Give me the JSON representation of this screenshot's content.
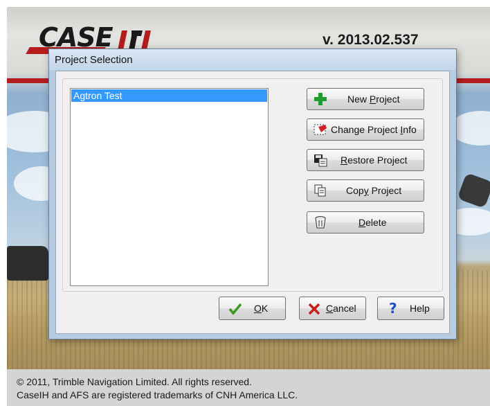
{
  "splash": {
    "brand_text": "CASE",
    "version": "v. 2013.02.537",
    "brand_red": "#b51d1d",
    "footer": {
      "copyright": "© 2011, Trimble Navigation Limited. All rights reserved.",
      "trademark": "CaseIH and AFS are registered trademarks of CNH America LLC."
    }
  },
  "dialog": {
    "title": "Project Selection",
    "projects": [
      "Agtron Test"
    ],
    "selected_project": "Agtron Test",
    "buttons": {
      "new_project": {
        "label_pre": "New ",
        "label_u": "P",
        "label_post": "roject",
        "icon": "plus-icon"
      },
      "change_info": {
        "label_pre": "Change Project ",
        "label_u": "I",
        "label_post": "nfo",
        "icon": "edit-icon"
      },
      "restore": {
        "label_pre": "",
        "label_u": "R",
        "label_post": "estore Project",
        "icon": "floppy-disk-icon"
      },
      "copy": {
        "label_pre": "Cop",
        "label_u": "y",
        "label_post": " Project",
        "icon": "copy-icon"
      },
      "delete": {
        "label_pre": "",
        "label_u": "D",
        "label_post": "elete",
        "icon": "trash-icon"
      },
      "ok": {
        "label_pre": "",
        "label_u": "O",
        "label_post": "K",
        "icon": "checkmark-icon"
      },
      "cancel": {
        "label_pre": "",
        "label_u": "C",
        "label_post": "ancel",
        "icon": "x-icon"
      },
      "help": {
        "label_pre": "",
        "label_u": "",
        "label_post": "Help",
        "icon": "question-icon"
      }
    }
  }
}
